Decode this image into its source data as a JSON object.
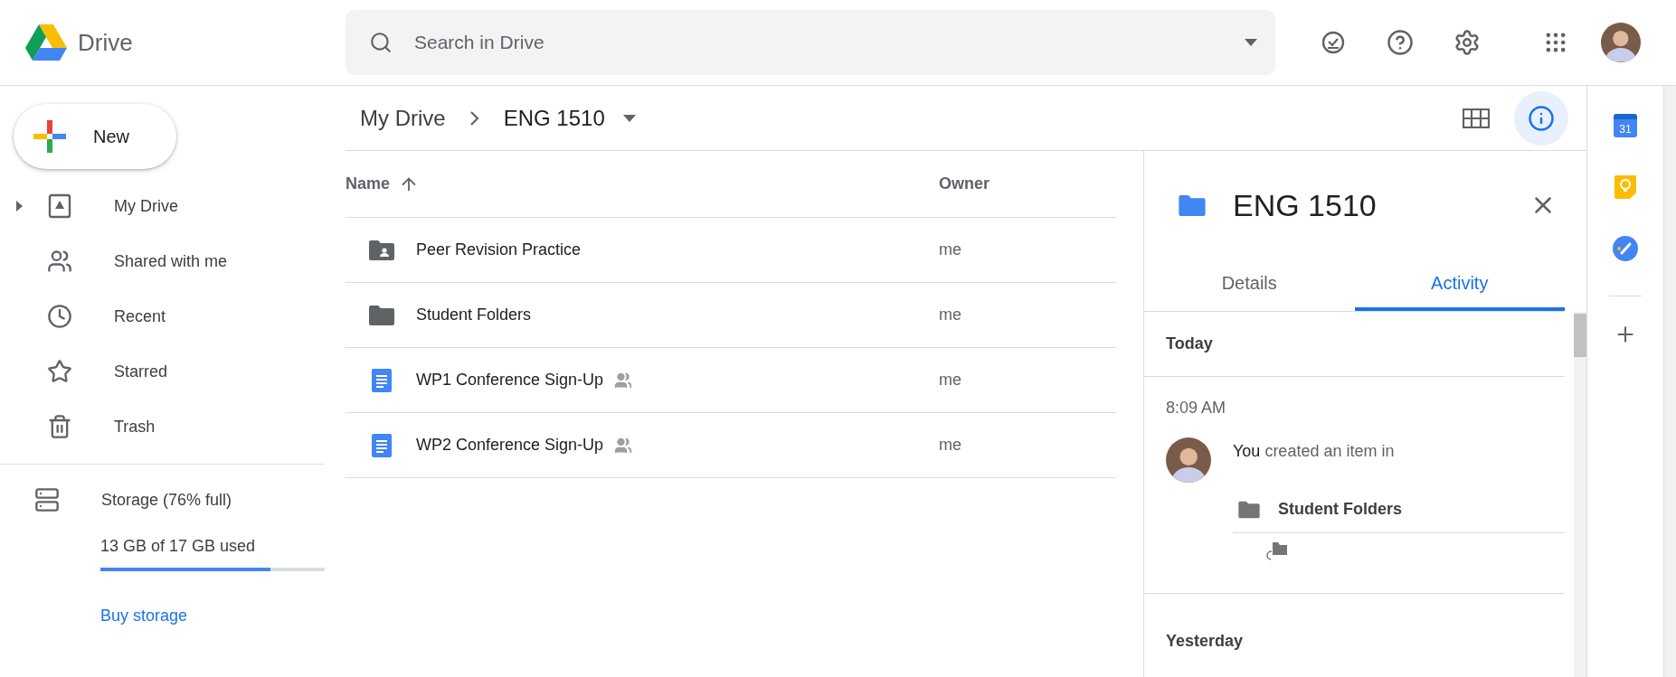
{
  "app": {
    "name": "Drive"
  },
  "search": {
    "placeholder": "Search in Drive"
  },
  "new_button": {
    "label": "New"
  },
  "nav": [
    {
      "label": "My Drive",
      "kind": "drive",
      "selected": false,
      "expanded": false
    },
    {
      "label": "Shared with me",
      "kind": "shared",
      "selected": false
    },
    {
      "label": "Recent",
      "kind": "recent",
      "selected": false
    },
    {
      "label": "Starred",
      "kind": "starred",
      "selected": false
    },
    {
      "label": "Trash",
      "kind": "trash",
      "selected": false
    }
  ],
  "storage": {
    "label": "Storage (76% full)",
    "usage": "13 GB of 17 GB used",
    "level": 0.76,
    "link": "Buy storage"
  },
  "breadcrumb": [
    "My Drive",
    "ENG 1510"
  ],
  "table": {
    "columns": [
      {
        "label": "Name",
        "sorted_ascending": true
      },
      {
        "label": "Owner"
      }
    ],
    "rows": [
      {
        "name": "Peer Revision Practice",
        "kind": "shared-folder",
        "shared": false,
        "owner": "me"
      },
      {
        "name": "Student Folders",
        "kind": "folder",
        "shared": false,
        "owner": "me"
      },
      {
        "name": "WP1 Conference Sign-Up",
        "kind": "doc",
        "shared": true,
        "owner": "me"
      },
      {
        "name": "WP2 Conference Sign-Up",
        "kind": "doc",
        "shared": true,
        "owner": "me"
      }
    ]
  },
  "details": {
    "title": "ENG 1510",
    "tabs": [
      {
        "label": "Details",
        "selected": false
      },
      {
        "label": "Activity",
        "selected": true
      }
    ],
    "activity": [
      {
        "kind": "day",
        "label": "Today"
      },
      {
        "kind": "event",
        "time": "8:09 AM",
        "text": "**You** created an item in",
        "target": "Student Folders"
      },
      {
        "kind": "day",
        "label": "Yesterday"
      }
    ]
  },
  "addons": [
    {
      "kind": "calendar",
      "label": "31"
    },
    {
      "kind": "keep"
    },
    {
      "kind": "tasks"
    }
  ]
}
